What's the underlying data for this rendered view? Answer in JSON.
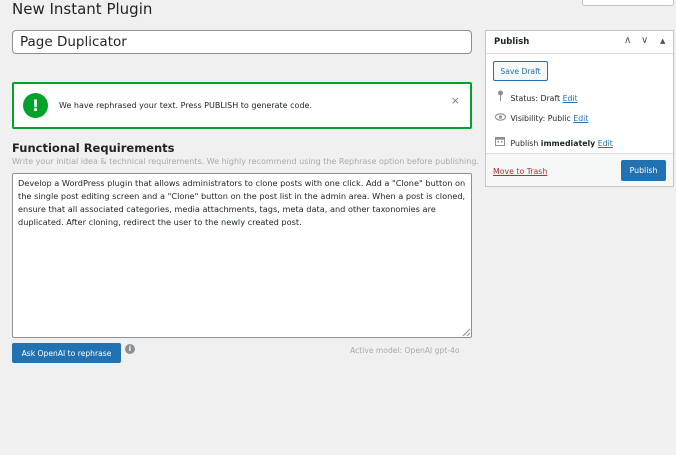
{
  "page": {
    "heading": "New Instant Plugin"
  },
  "title_field": {
    "value": "Page Duplicator"
  },
  "notice": {
    "icon": "!",
    "message": "We have rephrased your text. Press PUBLISH to generate code.",
    "close": "×"
  },
  "requirements": {
    "title": "Functional Requirements",
    "help": "Write your initial idea & technical requirements. We highly recommend using the Rephrase option before publishing.",
    "text": "Develop a WordPress plugin that allows administrators to clone posts with one click. Add a \"Clone\" button on the single post editing screen and a \"Clone\" button on the post list in the admin area. When a post is cloned, ensure that all associated categories, media attachments, tags, meta data, and other taxonomies are duplicated. After cloning, redirect the user to the newly created post.",
    "ask_button": "Ask OpenAI to rephrase",
    "info_icon": "i",
    "model": "Active model: OpenAI gpt-4o"
  },
  "publish_box": {
    "title": "Publish",
    "controls": {
      "up": "∧",
      "down": "∨",
      "toggle": "▲"
    },
    "save_draft": "Save Draft",
    "status_label": "Status:",
    "status_value": "Draft",
    "visibility_label": "Visibility:",
    "visibility_value": "Public",
    "publish_label": "Publish",
    "publish_value": "immediately",
    "edit": "Edit",
    "trash": "Move to Trash",
    "publish_button": "Publish"
  },
  "icons": {
    "status": "pin-icon",
    "visibility": "eye-icon",
    "schedule": "calendar-icon",
    "info": "info-icon",
    "notice": "success-icon"
  },
  "colors": {
    "accent": "#2271b1",
    "success": "#00a32a",
    "danger": "#b32d2e",
    "background": "#f0f0f1"
  }
}
